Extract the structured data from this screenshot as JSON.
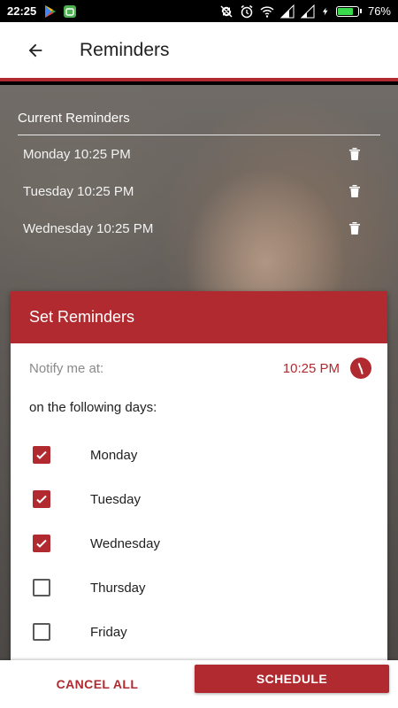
{
  "status_bar": {
    "time": "22:25",
    "battery_text": "76%",
    "battery_level": 0.76,
    "battery_color": "#38d94a"
  },
  "app_bar": {
    "title": "Reminders",
    "back_icon": "arrow-left-icon"
  },
  "current_reminders": {
    "header": "Current Reminders",
    "items": [
      {
        "label": "Monday 10:25 PM"
      },
      {
        "label": "Tuesday 10:25 PM"
      },
      {
        "label": "Wednesday 10:25 PM"
      }
    ],
    "delete_icon": "trash-icon"
  },
  "set_reminders": {
    "title": "Set Reminders",
    "notify_label": "Notify me at:",
    "notify_time": "10:25 PM",
    "clock_icon": "clock-icon",
    "days_label": "on the following days:",
    "days": [
      {
        "label": "Monday",
        "checked": true
      },
      {
        "label": "Tuesday",
        "checked": true
      },
      {
        "label": "Wednesday",
        "checked": true
      },
      {
        "label": "Thursday",
        "checked": false
      },
      {
        "label": "Friday",
        "checked": false
      }
    ]
  },
  "actions": {
    "cancel_label": "CANCEL ALL",
    "schedule_label": "SCHEDULE"
  },
  "colors": {
    "accent": "#b02a2f"
  }
}
